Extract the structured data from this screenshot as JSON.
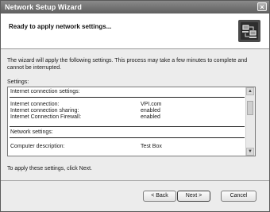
{
  "window": {
    "title": "Network Setup Wizard",
    "close_glyph": "×"
  },
  "header": {
    "heading": "Ready to apply network settings...",
    "icon": "network-wizard-icon"
  },
  "body": {
    "intro": "The wizard will apply the following settings. This process may take a few minutes to complete and cannot be interrupted.",
    "settings_label": "Settings:",
    "settings": {
      "internet_title": "Internet connection settings:",
      "internet_rows": [
        {
          "key": "Internet connection:",
          "value": "VPI.com"
        },
        {
          "key": "Internet connection sharing:",
          "value": "enabled"
        },
        {
          "key": "Internet Connection Firewall:",
          "value": "enabled"
        }
      ],
      "network_title": "Network settings:",
      "network_rows": [
        {
          "key": "Computer description:",
          "value": "Test Box"
        }
      ]
    },
    "scroll_up_glyph": "▲",
    "scroll_down_glyph": "▼",
    "apply_note": "To apply these settings, click Next."
  },
  "buttons": {
    "back": "< Back",
    "next": "Next >",
    "cancel": "Cancel"
  }
}
